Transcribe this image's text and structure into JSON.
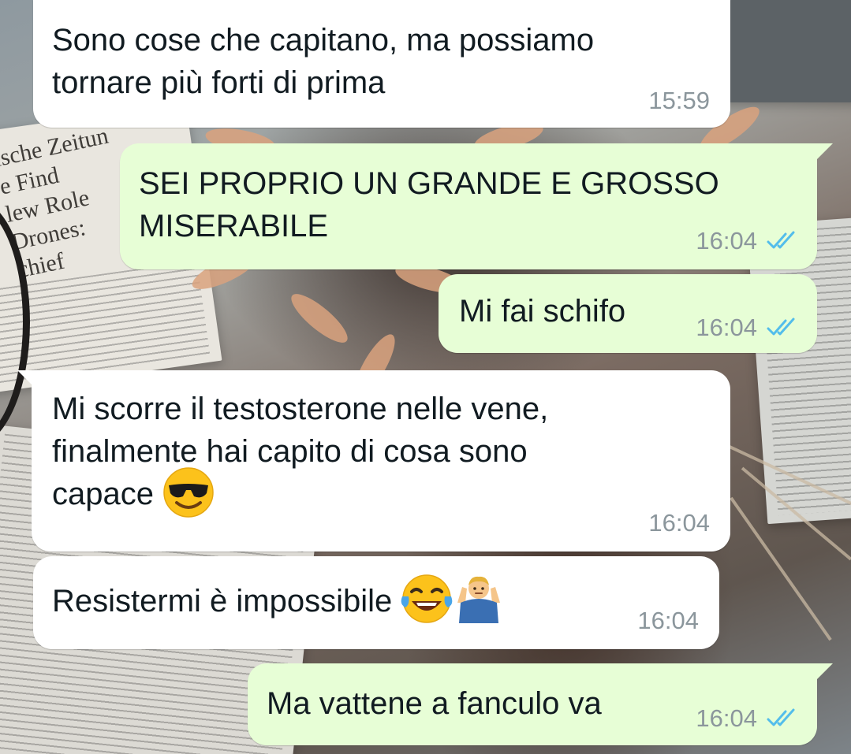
{
  "messages": [
    {
      "id": "m1",
      "direction": "incoming",
      "lines": [
        "Sono cose che capitano, ma possiamo",
        "tornare più forti di prima"
      ],
      "time": "15:59"
    },
    {
      "id": "m2",
      "direction": "outgoing",
      "lines": [
        "SEI PROPRIO UN GRANDE E GROSSO",
        "MISERABILE"
      ],
      "time": "16:04",
      "status": "read"
    },
    {
      "id": "m3",
      "direction": "outgoing",
      "lines": [
        "Mi fai schifo"
      ],
      "time": "16:04",
      "status": "read"
    },
    {
      "id": "m4",
      "direction": "incoming",
      "lines": [
        "Mi scorre il testosterone nelle vene,",
        "finalmente hai capito di cosa sono",
        "capace"
      ],
      "emojis": [
        "smiling-face-with-sunglasses"
      ],
      "time": "16:04"
    },
    {
      "id": "m5",
      "direction": "incoming",
      "lines": [
        "Resistermi è impossibile"
      ],
      "emojis": [
        "face-with-tears-of-joy",
        "man-shrugging"
      ],
      "time": "16:04"
    },
    {
      "id": "m6",
      "direction": "outgoing",
      "lines": [
        "Ma vattene a fanculo va"
      ],
      "time": "16:04",
      "status": "read"
    }
  ],
  "wallpaper": {
    "newspaper_lines": [
      "ische Zeitun",
      "e Find",
      "lew Role",
      "Drones:",
      "chief"
    ]
  },
  "colors": {
    "incoming_bubble": "#ffffff",
    "outgoing_bubble": "#e7fed6",
    "timestamp": "#8b969c",
    "read_ticks": "#53bdeb",
    "text": "#111b21"
  }
}
